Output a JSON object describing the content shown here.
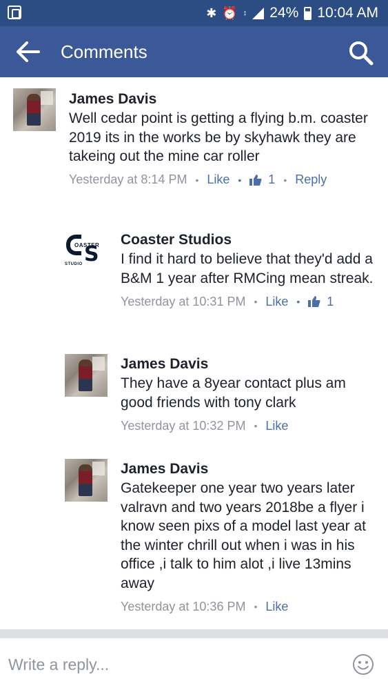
{
  "status_bar": {
    "icons": [
      "app-icon",
      "bluetooth-icon",
      "alarm-icon",
      "data-icon",
      "signal-icon",
      "battery-icon"
    ],
    "battery": "24%",
    "time": "10:04 AM"
  },
  "app_bar": {
    "title": "Comments",
    "back_icon": "back-arrow-icon",
    "search_icon": "search-icon",
    "color": "#3b5998"
  },
  "comments": [
    {
      "author": "James Davis",
      "text": "Well cedar point is getting a flying b.m. coaster 2019 its in the works be by skyhawk they are takeing out the mine car roller",
      "time": "Yesterday at 8:14 PM",
      "like_label": "Like",
      "like_count": "1",
      "reply_label": "Reply"
    },
    {
      "author": "Coaster Studios",
      "logo_text_top": "OASTER",
      "logo_text_bottom": "STUDIO",
      "text": "I find it hard to believe that they'd add a B&M 1 year after RMCing mean streak.",
      "time": "Yesterday at 10:31 PM",
      "like_label": "Like",
      "like_count": "1"
    },
    {
      "author": "James Davis",
      "text": "They have a 8year contact plus am good friends with tony clark",
      "time": "Yesterday at 10:32 PM",
      "like_label": "Like"
    },
    {
      "author": "James Davis",
      "text": "Gatekeeper one year two years later valravn and two years 2018be a flyer i know  seen pixs of a model last year at the winter chrill out  when i was in his office ,i talk to him alot ,i live 13mins away",
      "time": "Yesterday at 10:36 PM",
      "like_label": "Like"
    }
  ],
  "reply_bar": {
    "placeholder": "Write a reply...",
    "emoji_icon": "emoji-icon"
  },
  "colors": {
    "link": "#4b6fa8",
    "meta": "#90949c",
    "status_bar": "#2b4d84"
  }
}
